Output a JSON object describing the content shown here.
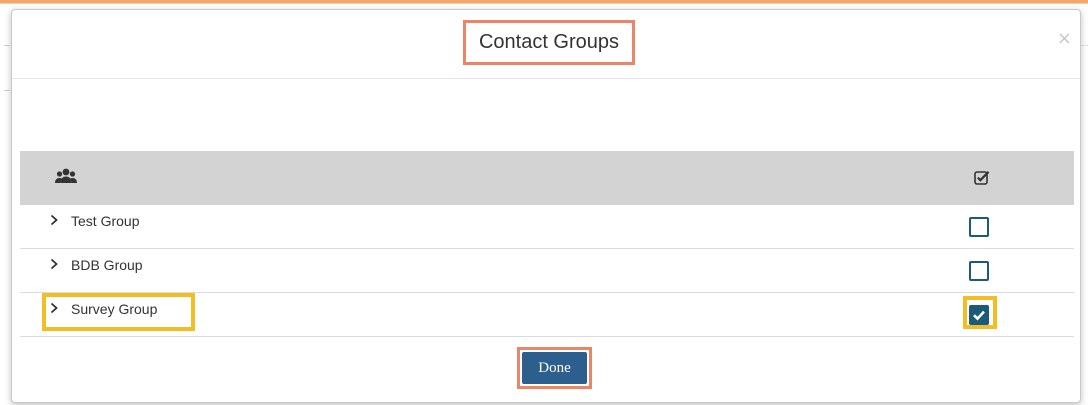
{
  "modal": {
    "title": "Contact Groups",
    "close_icon": "close-icon"
  },
  "table": {
    "header_icon": "users-icon",
    "select_all_icon": "check-square-icon",
    "rows": [
      {
        "label": "Test Group",
        "checked": false
      },
      {
        "label": "BDB Group",
        "checked": false
      },
      {
        "label": "Survey Group",
        "checked": true
      }
    ]
  },
  "footer": {
    "done_label": "Done"
  },
  "colors": {
    "accent_orange": "#ec8467",
    "highlight_yellow": "#f2be26",
    "checkbox_blue": "#1b5a7a",
    "button_blue": "#2c5f8d",
    "header_gray": "#d3d3d3"
  }
}
